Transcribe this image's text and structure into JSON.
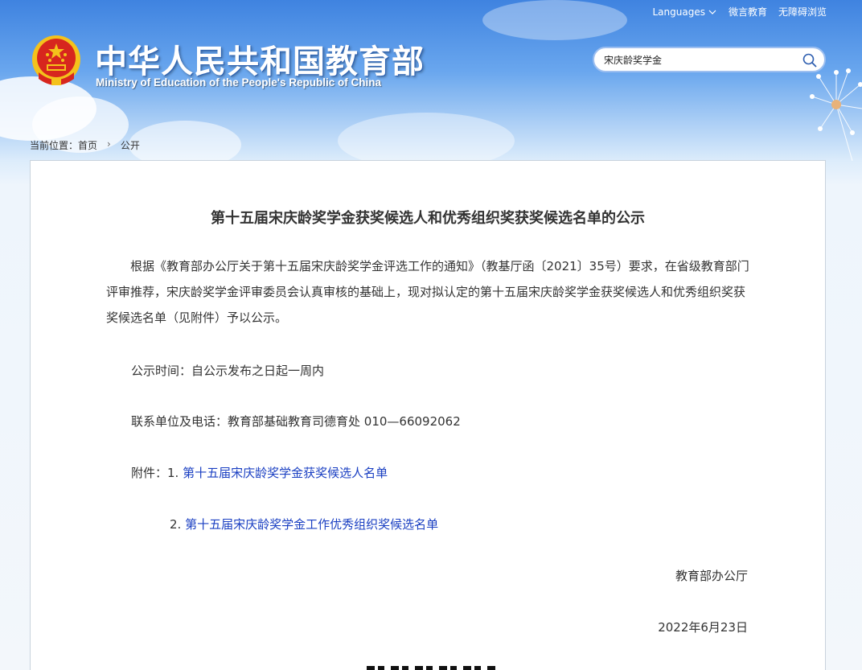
{
  "header": {
    "site_title": "中华人民共和国教育部",
    "site_subtitle": "Ministry of Education of the People's Republic of China",
    "topnav": {
      "languages": "Languages",
      "weiyan": "微言教育",
      "accessibility": "无障碍浏览"
    },
    "search": {
      "value": "宋庆龄奖学金"
    }
  },
  "breadcrumb": {
    "prefix": "当前位置：",
    "home": "首页",
    "current": "公开"
  },
  "article": {
    "title": "第十五届宋庆龄奖学金获奖候选人和优秀组织奖获奖候选名单的公示",
    "intro": "根据《教育部办公厅关于第十五届宋庆龄奖学金评选工作的通知》（教基厅函〔2021〕35号）要求，在省级教育部门评审推荐，宋庆龄奖学金评审委员会认真审核的基础上，现对拟认定的第十五届宋庆龄奖学金获奖候选人和优秀组织奖获奖候选名单（见附件）予以公示。",
    "period": "公示时间：自公示发布之日起一周内",
    "contact": "联系单位及电话：教育部基础教育司德育处 010—66092062",
    "attachments_label": "附件：",
    "attachments": [
      {
        "num": "1.",
        "title": "第十五届宋庆龄奖学金获奖候选人名单"
      },
      {
        "num": "2.",
        "title": "第十五届宋庆龄奖学金工作优秀组织奖候选名单"
      }
    ],
    "issuer": "教育部办公厅",
    "date": "2022年6月23日"
  },
  "colors": {
    "link": "#1a3fc2",
    "header_blue": "#3f83e0",
    "emblem_red": "#d7261e",
    "emblem_gold": "#f4c21b"
  }
}
